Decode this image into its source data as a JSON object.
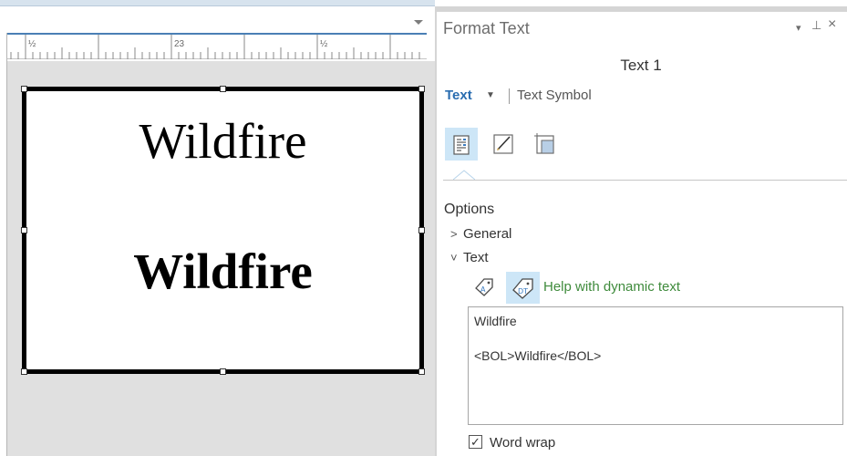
{
  "ruler": {
    "labels": [
      "½",
      "23",
      "½"
    ]
  },
  "layout": {
    "text_line_regular": "Wildfire",
    "text_line_bold": "Wildfire"
  },
  "pane": {
    "title": "Format Text",
    "controls": {
      "menu": "▾",
      "pin": "⊥",
      "close": "×"
    },
    "element_name": "Text 1",
    "tabs": {
      "text": "Text",
      "text_symbol": "Text Symbol"
    },
    "icons": [
      "options-icon",
      "pencil-icon",
      "text-frame-icon"
    ],
    "options_label": "Options",
    "general_label": "General",
    "text_section_label": "Text",
    "help_dynamic_text": "Help with dynamic text",
    "text_content": {
      "line1": "Wildfire",
      "line2": "",
      "line3": "<BOL>Wildfire</BOL>"
    },
    "word_wrap": {
      "label": "Word wrap",
      "checked": true,
      "mark": "✓"
    }
  },
  "colors": {
    "accent": "#2a6db0",
    "active_tool_bg": "#cde6f7",
    "help_link": "#3f8b3c"
  }
}
